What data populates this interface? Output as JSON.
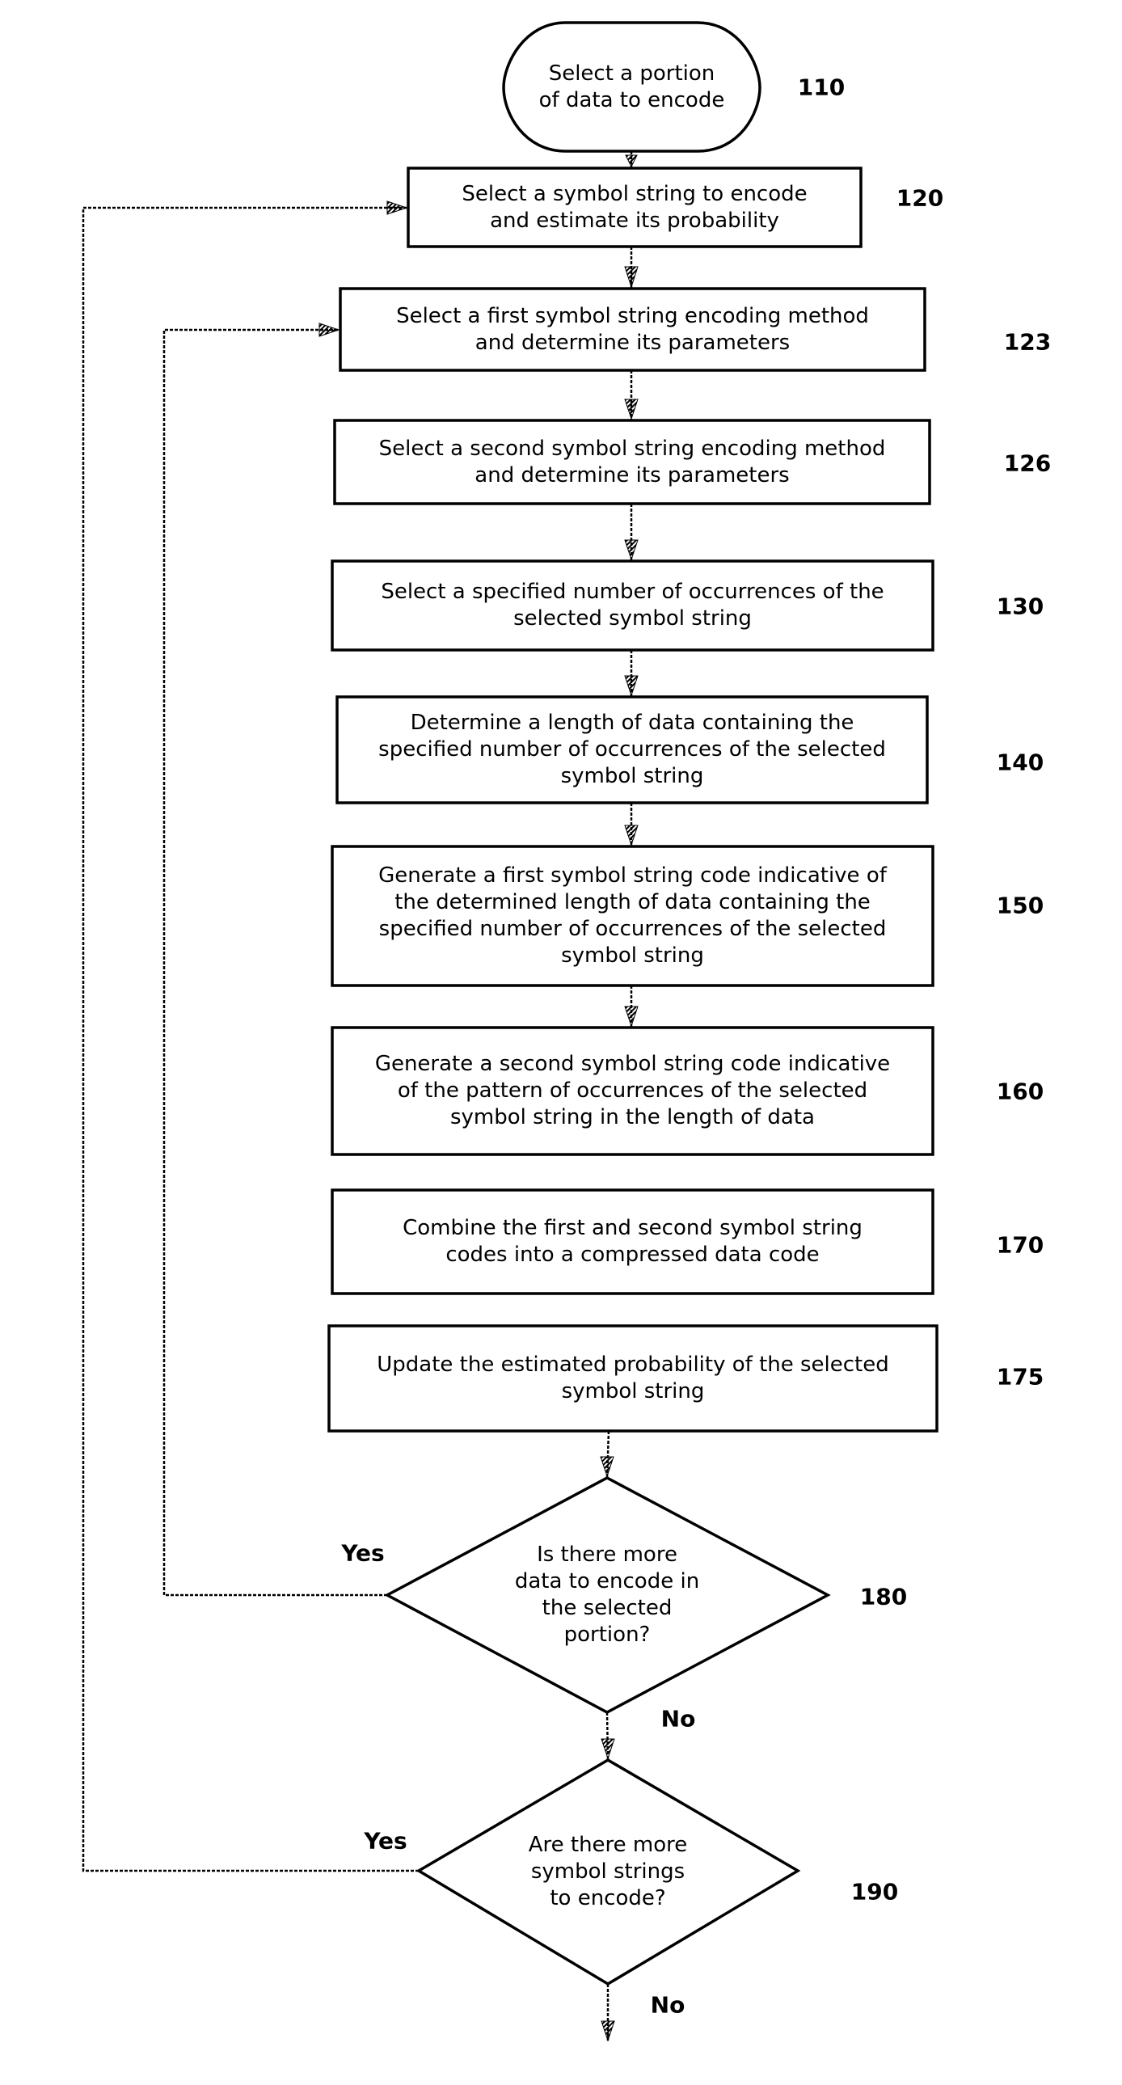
{
  "diagram": {
    "type": "flowchart",
    "nodes": [
      {
        "id": "110",
        "shape": "terminal",
        "text": "Select a portion\nof data to encode",
        "ref": "110"
      },
      {
        "id": "120",
        "shape": "process",
        "text": "Select a symbol string to encode\nand estimate its probability",
        "ref": "120"
      },
      {
        "id": "123",
        "shape": "process",
        "text": "Select a first symbol string encoding method\nand determine its parameters",
        "ref": "123"
      },
      {
        "id": "126",
        "shape": "process",
        "text": "Select a second symbol string encoding method\nand determine its parameters",
        "ref": "126"
      },
      {
        "id": "130",
        "shape": "process",
        "text": "Select a specified number of occurrences of the\nselected symbol string",
        "ref": "130"
      },
      {
        "id": "140",
        "shape": "process",
        "text": "Determine a length of data containing the\nspecified number of occurrences of the selected\nsymbol string",
        "ref": "140"
      },
      {
        "id": "150",
        "shape": "process",
        "text": "Generate a first symbol string code indicative of\nthe determined length of data containing the\nspecified number of occurrences of the selected\nsymbol string",
        "ref": "150"
      },
      {
        "id": "160",
        "shape": "process",
        "text": "Generate a second symbol string code indicative\nof the pattern of occurrences of the selected\nsymbol string  in the length of data",
        "ref": "160"
      },
      {
        "id": "170",
        "shape": "process",
        "text": "Combine the first and second symbol string\ncodes into a compressed data code",
        "ref": "170"
      },
      {
        "id": "175",
        "shape": "process",
        "text": "Update the estimated probability of the selected\nsymbol string",
        "ref": "175"
      },
      {
        "id": "180",
        "shape": "decision",
        "text": "Is there more\ndata to encode in\nthe selected\nportion?",
        "ref": "180",
        "yes_label": "Yes",
        "no_label": "No"
      },
      {
        "id": "190",
        "shape": "decision",
        "text": "Are there more\nsymbol strings\nto encode?",
        "ref": "190",
        "yes_label": "Yes",
        "no_label": "No"
      }
    ],
    "edges": [
      {
        "from": "110",
        "to": "120"
      },
      {
        "from": "120",
        "to": "123"
      },
      {
        "from": "123",
        "to": "126"
      },
      {
        "from": "126",
        "to": "130"
      },
      {
        "from": "130",
        "to": "140"
      },
      {
        "from": "140",
        "to": "150"
      },
      {
        "from": "150",
        "to": "160"
      },
      {
        "from": "160",
        "to": "170"
      },
      {
        "from": "175",
        "to": "180"
      },
      {
        "from": "180",
        "to": "123",
        "label": "Yes"
      },
      {
        "from": "180",
        "to": "190",
        "label": "No"
      },
      {
        "from": "190",
        "to": "120",
        "label": "Yes"
      },
      {
        "from": "190",
        "to": "end",
        "label": "No"
      }
    ]
  }
}
